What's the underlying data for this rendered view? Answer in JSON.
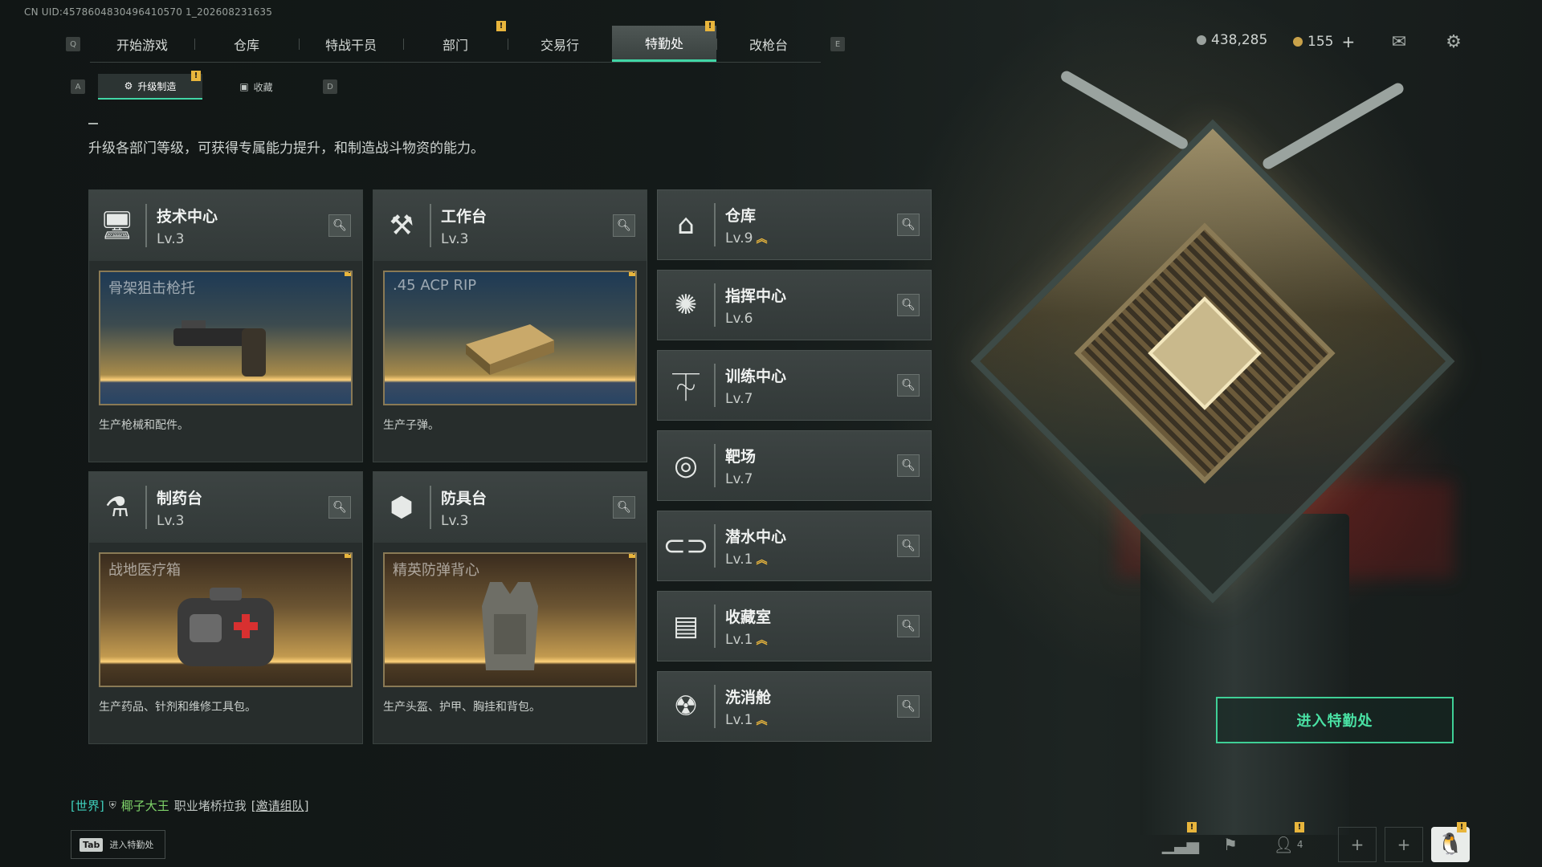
{
  "uid": "CN UID:4578604830496410570 1_202608231635",
  "topnav": {
    "left_key": "Q",
    "right_key": "E",
    "tabs": [
      {
        "label": "开始游戏",
        "badge": false
      },
      {
        "label": "仓库",
        "badge": false
      },
      {
        "label": "特战干员",
        "badge": false
      },
      {
        "label": "部门",
        "badge": true
      },
      {
        "label": "交易行",
        "badge": false
      },
      {
        "label": "特勤处",
        "badge": true,
        "active": true
      },
      {
        "label": "改枪台",
        "badge": false
      }
    ],
    "badge_text": "!"
  },
  "currency": {
    "silver": "438,285",
    "gold": "155",
    "gold_add": "+"
  },
  "subnav": {
    "left_key": "A",
    "right_key": "D",
    "tabs": [
      {
        "label": "升级制造",
        "active": true,
        "badge": true,
        "icon": "gear-arrow-icon"
      },
      {
        "label": "收藏",
        "active": false,
        "badge": false,
        "icon": "collection-icon"
      }
    ]
  },
  "description": "升级各部门等级，可获得专属能力提升，和制造战斗物资的能力。",
  "cards": [
    {
      "name": "技术中心",
      "level": "Lv.3",
      "icon": "monitor-icon",
      "product": "骨架狙击枪托",
      "product_style": "blue",
      "footer": "生产枪械和配件。"
    },
    {
      "name": "工作台",
      "level": "Lv.3",
      "icon": "tools-icon",
      "product": ".45 ACP RIP",
      "product_style": "blue",
      "footer": "生产子弹。"
    },
    {
      "name": "制药台",
      "level": "Lv.3",
      "icon": "pharmacy-icon",
      "product": "战地医疗箱",
      "product_style": "med",
      "footer": "生产药品、针剂和维修工具包。"
    },
    {
      "name": "防具台",
      "level": "Lv.3",
      "icon": "armor-blocks-icon",
      "product": "精英防弹背心",
      "product_style": "med",
      "footer": "生产头盔、护甲、胸挂和背包。"
    }
  ],
  "departments": [
    {
      "name": "仓库",
      "level": "Lv.9",
      "upgrade": true,
      "icon": "warehouse-icon"
    },
    {
      "name": "指挥中心",
      "level": "Lv.6",
      "upgrade": false,
      "icon": "command-icon"
    },
    {
      "name": "训练中心",
      "level": "Lv.7",
      "upgrade": false,
      "icon": "dumbbell-icon"
    },
    {
      "name": "靶场",
      "level": "Lv.7",
      "upgrade": false,
      "icon": "target-icon"
    },
    {
      "name": "潜水中心",
      "level": "Lv.1",
      "upgrade": true,
      "icon": "diving-mask-icon"
    },
    {
      "name": "收藏室",
      "level": "Lv.1",
      "upgrade": true,
      "icon": "display-case-icon"
    },
    {
      "name": "洗消舱",
      "level": "Lv.1",
      "upgrade": true,
      "icon": "decon-chamber-icon"
    }
  ],
  "enter_button": "进入特勤处",
  "chat": {
    "channel": "[世界]",
    "name": "椰子大王",
    "message": "职业堵桥拉我",
    "action": "[邀请组队]"
  },
  "tab_hint": {
    "key": "Tab",
    "label": "进入特勤处"
  },
  "bottom_bar": {
    "friends_count": "4"
  },
  "colors": {
    "accent": "#41d6a6",
    "badge": "#e8b53c",
    "enter_button": "#3fcf96"
  }
}
